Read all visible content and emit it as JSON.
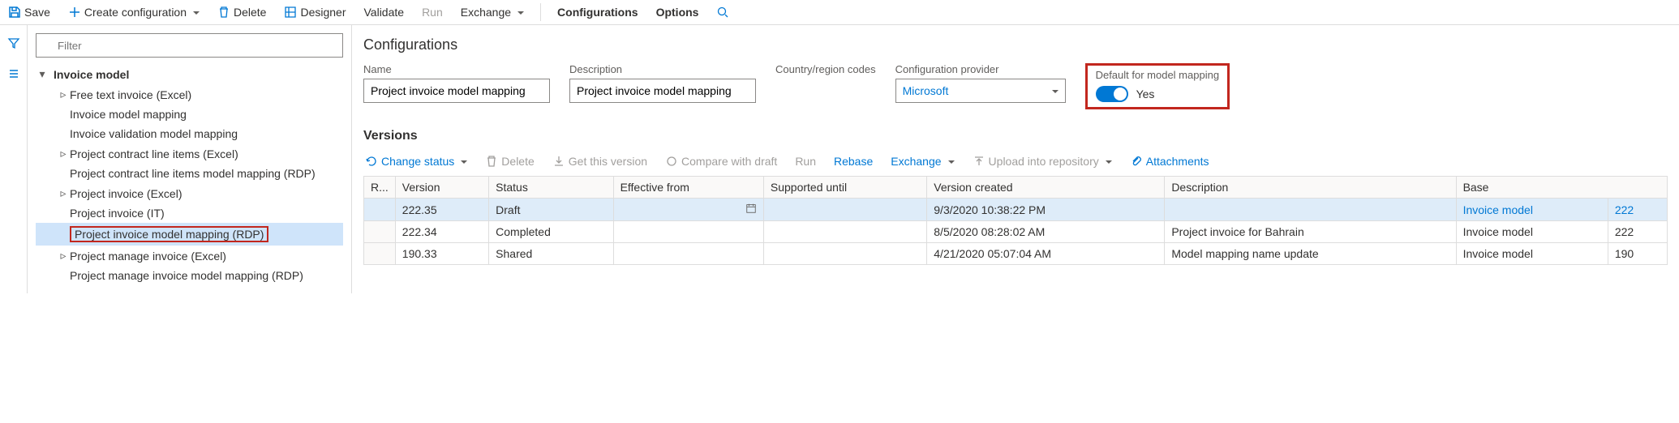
{
  "toolbar": {
    "save": "Save",
    "create": "Create configuration",
    "delete": "Delete",
    "designer": "Designer",
    "validate": "Validate",
    "run": "Run",
    "exchange": "Exchange",
    "configurations": "Configurations",
    "options": "Options"
  },
  "filter": {
    "placeholder": "Filter"
  },
  "tree": {
    "root": "Invoice model",
    "items": [
      {
        "label": "Free text invoice (Excel)",
        "chevron": true
      },
      {
        "label": "Invoice model mapping",
        "chevron": false
      },
      {
        "label": "Invoice validation model mapping",
        "chevron": false
      },
      {
        "label": "Project contract line items (Excel)",
        "chevron": true
      },
      {
        "label": "Project contract line items model mapping (RDP)",
        "chevron": false
      },
      {
        "label": "Project invoice (Excel)",
        "chevron": true
      },
      {
        "label": "Project invoice (IT)",
        "chevron": false
      },
      {
        "label": "Project invoice model mapping (RDP)",
        "chevron": false,
        "selected": true
      },
      {
        "label": "Project manage invoice (Excel)",
        "chevron": true
      },
      {
        "label": "Project manage invoice model mapping (RDP)",
        "chevron": false
      }
    ]
  },
  "content": {
    "title": "Configurations",
    "name_label": "Name",
    "name_value": "Project invoice model mapping",
    "desc_label": "Description",
    "desc_value": "Project invoice model mapping",
    "country_label": "Country/region codes",
    "provider_label": "Configuration provider",
    "provider_value": "Microsoft",
    "default_label": "Default for model mapping",
    "default_value": "Yes"
  },
  "versions": {
    "title": "Versions",
    "toolbar": {
      "change_status": "Change status",
      "delete": "Delete",
      "get": "Get this version",
      "compare": "Compare with draft",
      "run": "Run",
      "rebase": "Rebase",
      "exchange": "Exchange",
      "upload": "Upload into repository",
      "attachments": "Attachments"
    },
    "headers": {
      "row": "R...",
      "version": "Version",
      "status": "Status",
      "effective": "Effective from",
      "supported": "Supported until",
      "created": "Version created",
      "description": "Description",
      "base": "Base"
    },
    "rows": [
      {
        "version": "222.35",
        "status": "Draft",
        "effective": "",
        "supported": "",
        "created": "9/3/2020 10:38:22 PM",
        "description": "",
        "base": "Invoice model",
        "base_num": "222",
        "selected": true
      },
      {
        "version": "222.34",
        "status": "Completed",
        "effective": "",
        "supported": "",
        "created": "8/5/2020 08:28:02 AM",
        "description": "Project invoice for Bahrain",
        "base": "Invoice model",
        "base_num": "222"
      },
      {
        "version": "190.33",
        "status": "Shared",
        "effective": "",
        "supported": "",
        "created": "4/21/2020 05:07:04 AM",
        "description": "Model mapping name update",
        "base": "Invoice model",
        "base_num": "190"
      }
    ]
  }
}
